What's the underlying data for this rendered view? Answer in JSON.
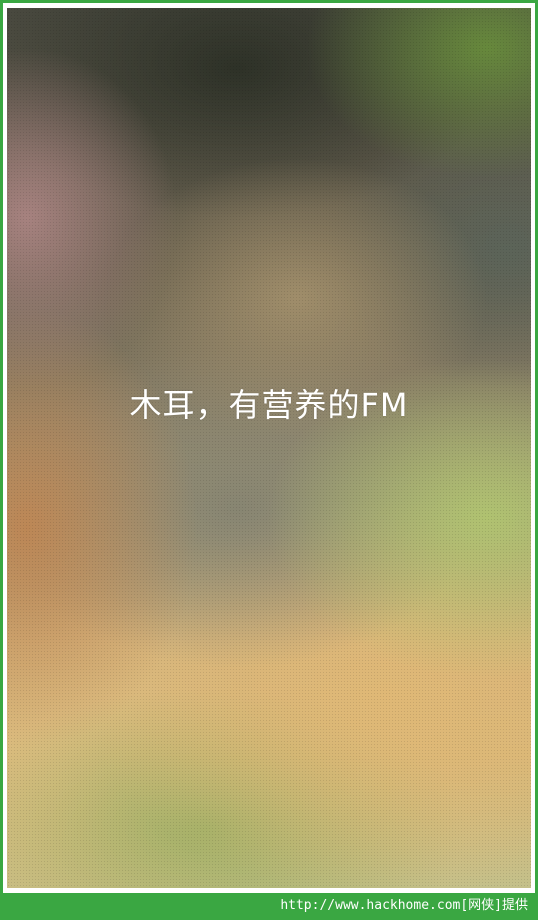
{
  "splash": {
    "tagline": "木耳，有营养的FM"
  },
  "watermark": {
    "text": "http://www.hackhome.com[网侠]提供"
  },
  "colors": {
    "frame": "#3aa742",
    "tagline_text": "#ffffff"
  }
}
